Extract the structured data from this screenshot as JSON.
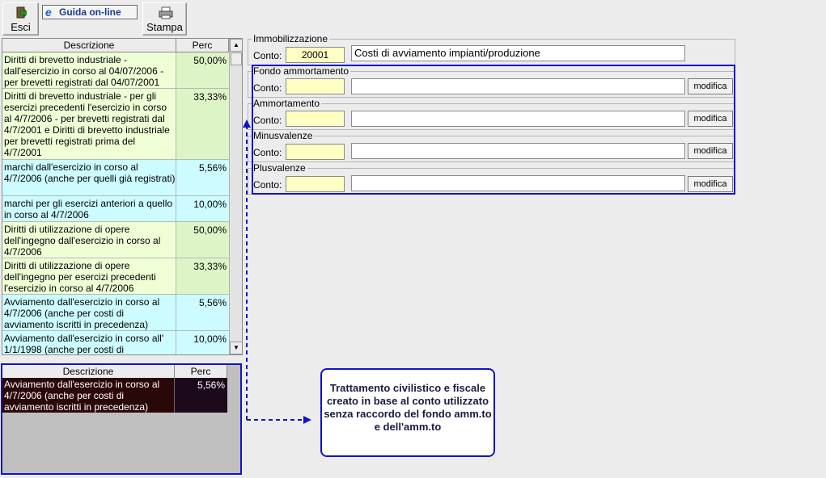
{
  "toolbar": {
    "esci": "Esci",
    "guida": "Guida on-line",
    "stampa": "Stampa"
  },
  "grid": {
    "headers": {
      "descrizione": "Descrizione",
      "perc": "Perc"
    },
    "rows": [
      {
        "desc": "Diritti di brevetto industriale - dall'esercizio in corso al 04/07/2006 - per brevetti registrati dal 04/07/2001",
        "perc": "50,00%"
      },
      {
        "desc": "Diritti di brevetto industriale  - per gli esercizi precedenti l'esercizio in corso al 4/7/2006 - per brevetti registrati dal 4/7/2001 e Diritti di brevetto industriale  per brevetti registrati prima del 4/7/2001",
        "perc": "33,33%"
      },
      {
        "desc": "marchi dall'esercizio in corso al 4/7/2006 (anche per quelli già registrati)",
        "perc": "5,56%"
      },
      {
        "desc": "marchi per gli esercizi anteriori a quello in corso al 4/7/2006",
        "perc": "10,00%"
      },
      {
        "desc": "Diritti di utilizzazione di opere dell'ingegno dall'esercizio in corso al 4/7/2006",
        "perc": "50,00%"
      },
      {
        "desc": "Diritti di utilizzazione di opere dell'ingegno per esercizi precedenti l'esercizio in corso al 4/7/2006",
        "perc": "33,33%"
      },
      {
        "desc": "Avviamento dall'esercizio in corso al 4/7/2006  (anche per costi di avviamento iscritti in precedenza)",
        "perc": "5,56%"
      },
      {
        "desc": "Avviamento dall'esercizio in corso all' 1/1/1998  (anche per costi di",
        "perc": "10,00%"
      }
    ]
  },
  "selected": {
    "headers": {
      "descrizione": "Descrizione",
      "perc": "Perc"
    },
    "desc": "Avviamento dall'esercizio in corso al 4/7/2006  (anche per costi di avviamento iscritti in precedenza)",
    "perc": "5,56%"
  },
  "immobilizzazione": {
    "title": "Immobilizzazione",
    "conto_label": "Conto:",
    "conto": "20001",
    "descrizione": "Costi di avviamento impianti/produzione"
  },
  "sections": [
    {
      "title": "Fondo ammortamento",
      "conto_label": "Conto:",
      "button": "modifica"
    },
    {
      "title": "Ammortamento",
      "conto_label": "Conto:",
      "button": "modifica"
    },
    {
      "title": "Minusvalenze",
      "conto_label": "Conto:",
      "button": "modifica"
    },
    {
      "title": "Plusvalenze",
      "conto_label": "Conto:",
      "button": "modifica"
    }
  ],
  "note": "Trattamento civilistico e fiscale creato in base al conto utilizzato senza raccordo del fondo amm.to e dell'amm.to",
  "colors": {
    "accent_blue": "#1212c8",
    "row_green": "#eeffd6",
    "row_cyan": "#ccfcff",
    "field_yellow": "#ffffc4",
    "selected_row": "#2b0808"
  }
}
